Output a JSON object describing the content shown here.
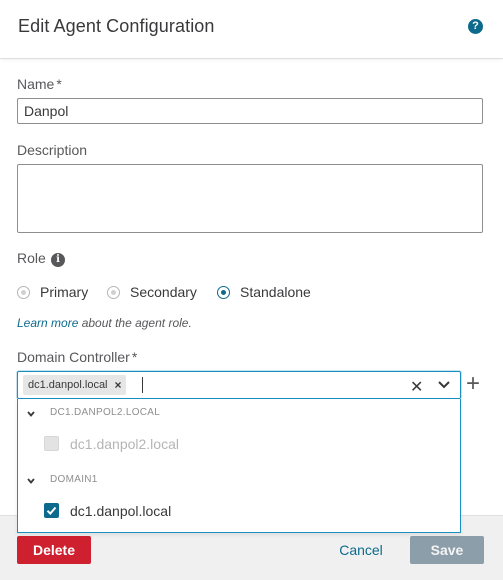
{
  "dialog": {
    "title": "Edit Agent Configuration",
    "help_icon": "question-circle-icon"
  },
  "name_field": {
    "label": "Name",
    "required_mark": "*",
    "value": "Danpol"
  },
  "description_field": {
    "label": "Description",
    "value": ""
  },
  "role": {
    "label": "Role",
    "info_icon": "info-icon",
    "options": [
      {
        "label": "Primary",
        "selected": false
      },
      {
        "label": "Secondary",
        "selected": false
      },
      {
        "label": "Standalone",
        "selected": true
      }
    ],
    "learn_more_link": "Learn more",
    "learn_more_text": " about the agent role."
  },
  "domain_controller": {
    "label": "Domain Controller",
    "required_mark": "*",
    "selected_chip": "dc1.danpol.local",
    "chip_remove": "×",
    "clear_glyph": "✕",
    "add_glyph": "+",
    "groups": [
      {
        "name": "DC1.DANPOL2.LOCAL",
        "options": [
          {
            "label": "dc1.danpol2.local",
            "checked": false,
            "disabled": true
          }
        ]
      },
      {
        "name": "DOMAIN1",
        "options": [
          {
            "label": "dc1.danpol.local",
            "checked": true,
            "disabled": false
          }
        ]
      }
    ]
  },
  "footer": {
    "delete_label": "Delete",
    "cancel_label": "Cancel",
    "save_label": "Save"
  },
  "colors": {
    "accent": "#0d6a8c",
    "danger": "#cf2030",
    "save_disabled": "#8b9ea9",
    "focus_border": "#1b8fc1"
  }
}
